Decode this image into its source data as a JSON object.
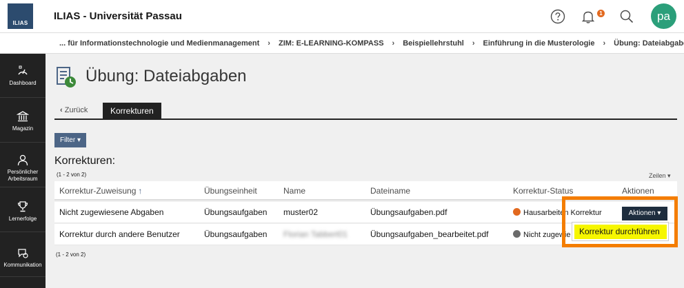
{
  "header": {
    "logo_text": "ILIAS",
    "title": "ILIAS - Universität Passau",
    "notification_count": "1",
    "avatar_initials": "pa"
  },
  "breadcrumb": [
    "... für Informationstechnologie und Medienmanagement",
    "ZIM: E-LEARNING-KOMPASS",
    "Beispiellehrstuhl",
    "Einführung in die Musterologie",
    "Übung: Dateiabgaben"
  ],
  "sidebar": {
    "items": [
      {
        "label": "Dashboard",
        "icon": "dashboard-icon"
      },
      {
        "label": "Magazin",
        "icon": "library-icon"
      },
      {
        "label_line1": "Persönlicher",
        "label_line2": "Arbeitsraum",
        "icon": "person-icon"
      },
      {
        "label": "Lernerfolge",
        "icon": "trophy-icon"
      },
      {
        "label": "Kommunikation",
        "icon": "chat-icon"
      }
    ]
  },
  "page": {
    "title": "Übung: Dateiabgaben",
    "tabs": {
      "back": "Zurück",
      "active": "Korrekturen"
    },
    "filter_label": "Filter",
    "section_title": "Korrekturen:",
    "count_top": "(1 - 2 von 2)",
    "count_bottom": "(1 - 2 von 2)",
    "rows_label": "Zeilen"
  },
  "table": {
    "headers": [
      "Korrektur-Zuweisung",
      "Übungseinheit",
      "Name",
      "Dateiname",
      "Korrektur-Status",
      "Aktionen"
    ],
    "rows": [
      {
        "assignment": "Nicht zugewiesene Abgaben",
        "unit": "Übungsaufgaben",
        "name": "muster02",
        "file": "Übungsaufgaben.pdf",
        "status": "Hausarbeiten Korrektur",
        "status_color": "#e2691f"
      },
      {
        "assignment": "Korrektur durch andere Benutzer",
        "unit": "Übungsaufgaben",
        "name": "Florian Tabbert01",
        "file": "Übungsaufgaben_bearbeitet.pdf",
        "status": "Nicht zugewie",
        "status_color": "#6b6b6b"
      }
    ],
    "actions_label": "Aktionen",
    "dropdown_item": "Korrektur durchführen"
  },
  "colors": {
    "accent": "#4c6586",
    "highlight": "#f47d00",
    "sidebar": "#222222"
  }
}
